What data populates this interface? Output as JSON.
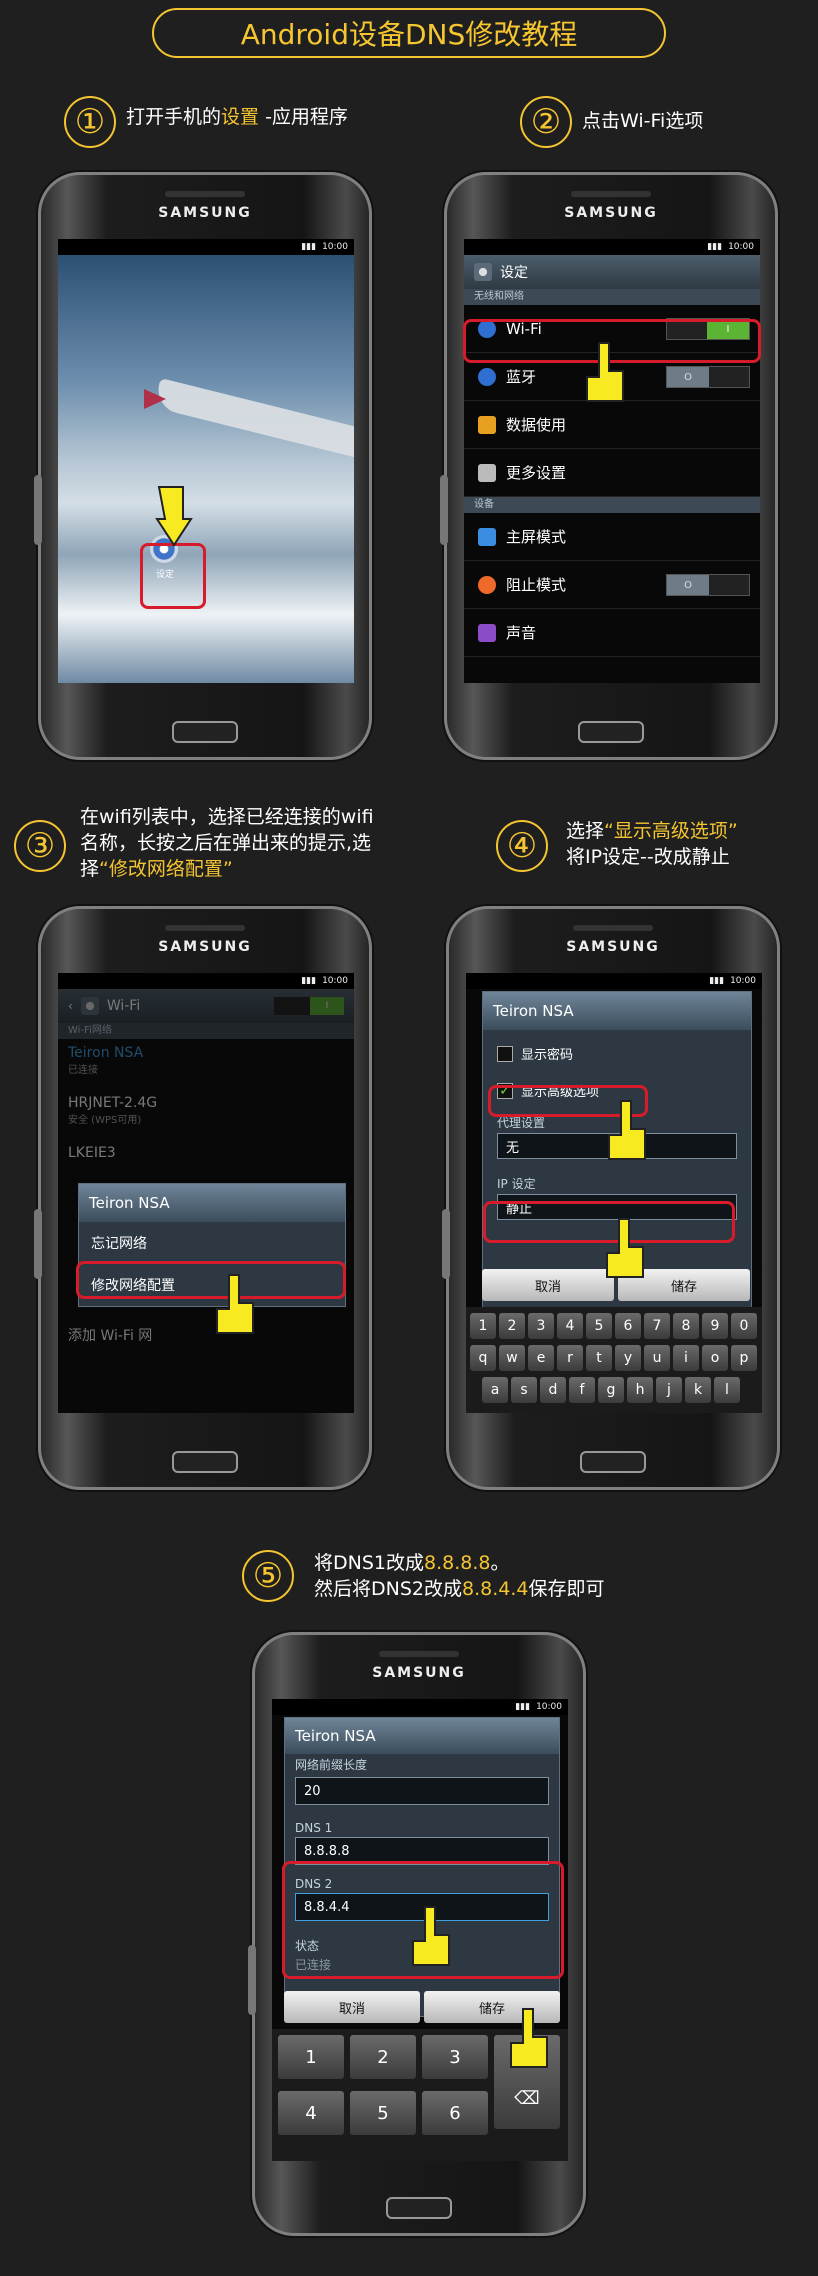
{
  "title": "Android设备DNS修改教程",
  "steps": [
    {
      "num": "①",
      "lines": [
        {
          "parts": [
            {
              "t": "打开手机的",
              "h": false
            },
            {
              "t": "设置",
              "h": true
            },
            {
              "t": " -应用程序",
              "h": false
            }
          ]
        }
      ]
    },
    {
      "num": "②",
      "lines": [
        {
          "parts": [
            {
              "t": "点击Wi-Fi选项",
              "h": false
            }
          ]
        }
      ]
    },
    {
      "num": "③",
      "lines": [
        {
          "parts": [
            {
              "t": "在wifi列表中，选择已经连接的wifi",
              "h": false
            }
          ]
        },
        {
          "parts": [
            {
              "t": "名称，长按之后在弹出来的提示,选",
              "h": false
            }
          ]
        },
        {
          "parts": [
            {
              "t": "择",
              "h": false
            },
            {
              "t": "“修改网络配置”",
              "h": true
            }
          ]
        }
      ]
    },
    {
      "num": "④",
      "lines": [
        {
          "parts": [
            {
              "t": "选择",
              "h": false
            },
            {
              "t": "“显示高级选项”",
              "h": true
            }
          ]
        },
        {
          "parts": [
            {
              "t": "将IP设定--改成静止",
              "h": false
            }
          ]
        }
      ]
    },
    {
      "num": "⑤",
      "lines": [
        {
          "parts": [
            {
              "t": "将DNS1改成",
              "h": false
            },
            {
              "t": "8.8.8.8",
              "h": true
            },
            {
              "t": "。",
              "h": false
            }
          ]
        },
        {
          "parts": [
            {
              "t": "然后将DNS2改成",
              "h": false
            },
            {
              "t": "8.8.4.4",
              "h": true
            },
            {
              "t": "保存即可",
              "h": false
            }
          ]
        }
      ]
    }
  ],
  "phone": {
    "brand": "SAMSUNG",
    "time": "10:00"
  },
  "screen1": {
    "icon_label": "设定"
  },
  "screen2": {
    "header": "设定",
    "section1": "无线和网络",
    "items1": [
      "Wi-Fi",
      "蓝牙",
      "数据使用",
      "更多设置"
    ],
    "section2": "设备",
    "items2": [
      "主屏模式",
      "阻止模式",
      "声音"
    ],
    "wifi_toggle": "I",
    "bt_toggle": "O",
    "block_toggle": "O"
  },
  "screen3": {
    "header": "Wi-Fi",
    "toggle": "I",
    "section": "Wi-Fi网络",
    "networks": [
      {
        "name": "Teiron NSA",
        "status": "已连接"
      },
      {
        "name": "HRJNET-2.4G",
        "status": "安全 (WPS可用)"
      },
      {
        "name": "LKEIE3",
        "status": ""
      }
    ],
    "dialog_title": "Teiron NSA",
    "menu": [
      "忘记网络",
      "修改网络配置"
    ],
    "add_wifi": "添加 Wi-Fi 网"
  },
  "screen4": {
    "dialog_title": "Teiron NSA",
    "show_password": "显示密码",
    "show_advanced": "显示高级选项",
    "proxy_label": "代理设置",
    "proxy_value": "无",
    "ip_label": "IP 设定",
    "ip_value": "静止",
    "cancel": "取消",
    "save": "储存",
    "keys_row1": [
      "1",
      "2",
      "3",
      "4",
      "5",
      "6",
      "7",
      "8",
      "9",
      "0"
    ],
    "keys_row2": [
      "q",
      "w",
      "e",
      "r",
      "t",
      "y",
      "u",
      "i",
      "o",
      "p"
    ],
    "keys_row3": [
      "a",
      "s",
      "d",
      "f",
      "g",
      "h",
      "j",
      "k",
      "l"
    ]
  },
  "screen5": {
    "dialog_title": "Teiron NSA",
    "prefix_label": "网络前缀长度",
    "prefix_value": "20",
    "dns1_label": "DNS 1",
    "dns1_value": "8.8.8.8",
    "dns2_label": "DNS 2",
    "dns2_value": "8.8.4.4",
    "state_label": "状态",
    "state_value": "已连接",
    "cancel": "取消",
    "save": "储存",
    "numpad": [
      "1",
      "2",
      "3",
      "4",
      "5",
      "6"
    ],
    "backspace": "⌫"
  }
}
